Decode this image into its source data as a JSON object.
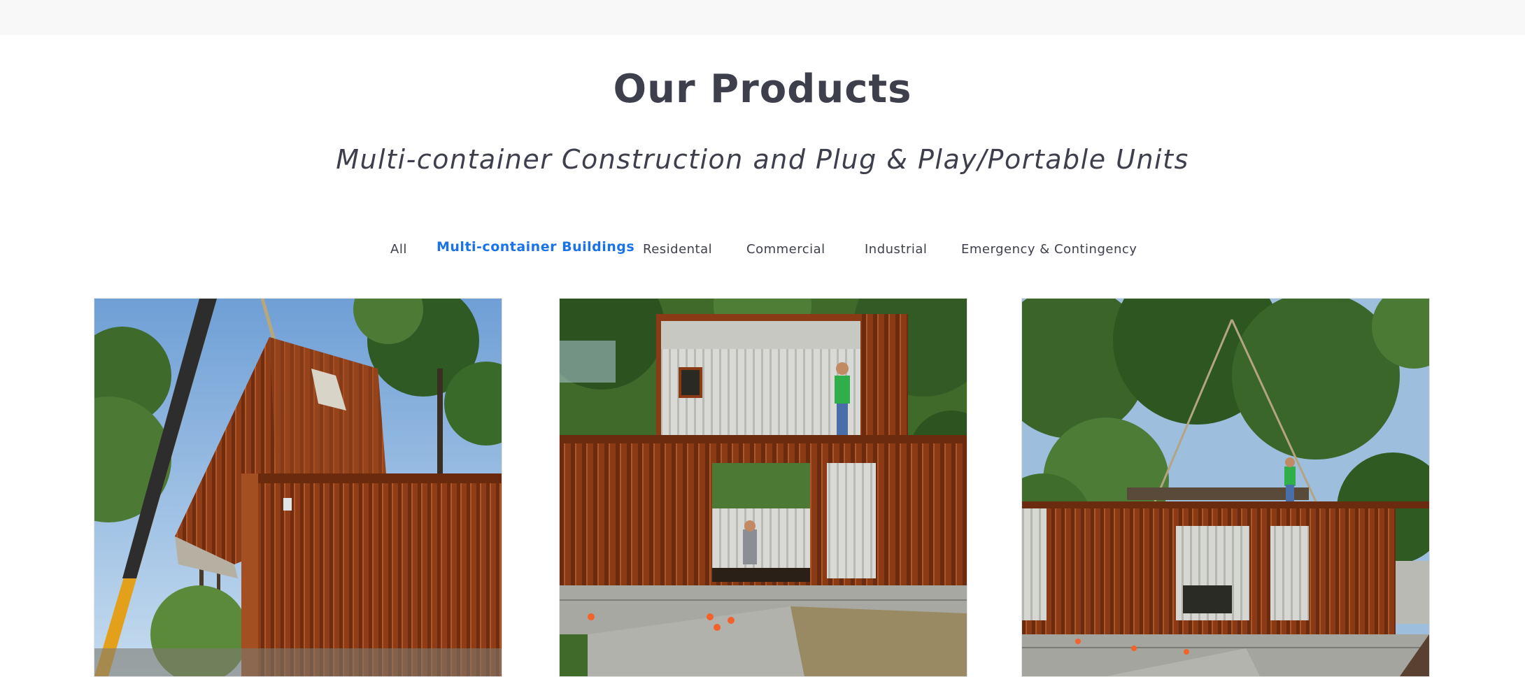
{
  "section": {
    "title": "Our Products",
    "subtitle": "Multi-container Construction and Plug & Play/Portable Units"
  },
  "filters": {
    "active_index": 1,
    "items": [
      {
        "label": "All"
      },
      {
        "label": "Multi-container Buildings"
      },
      {
        "label": "Residental"
      },
      {
        "label": "Commercial"
      },
      {
        "label": "Industrial"
      },
      {
        "label": "Emergency & Contingency"
      }
    ]
  },
  "gallery": {
    "items": [
      {
        "subject": "stacked-shipping-container-lifted-by-crane"
      },
      {
        "subject": "two-level-container-building-on-block-foundation"
      },
      {
        "subject": "container-placed-on-foundation-with-worker"
      }
    ]
  },
  "colors": {
    "accent": "#1a73e8",
    "text": "#3d3f4d",
    "container_rust": "#8b3a14",
    "topbar": "#f8f8f8"
  }
}
